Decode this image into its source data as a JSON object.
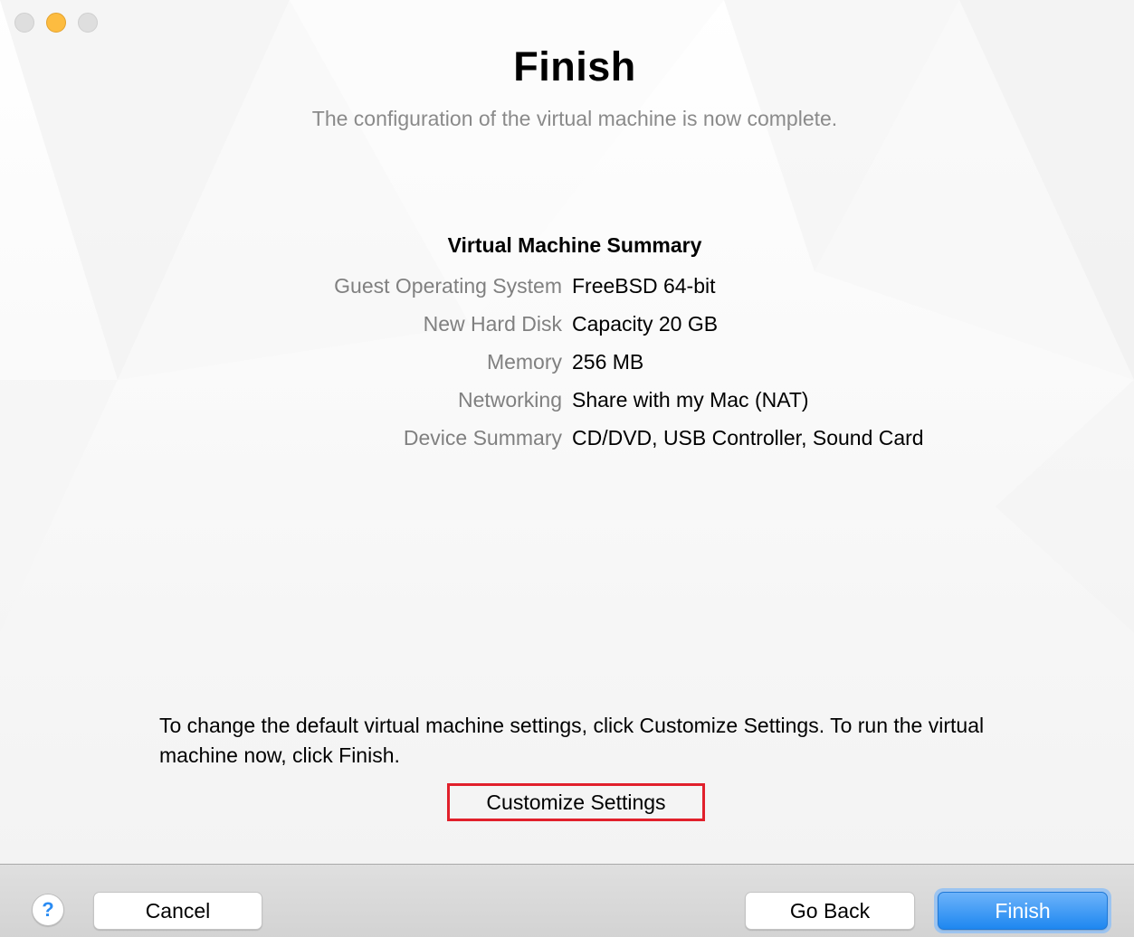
{
  "window": {
    "controls": [
      "close",
      "minimize",
      "zoom"
    ]
  },
  "header": {
    "title": "Finish",
    "subtitle": "The configuration of the virtual machine is now complete."
  },
  "summary": {
    "heading": "Virtual Machine Summary",
    "rows": [
      {
        "label": "Guest Operating System",
        "value": "FreeBSD 64-bit"
      },
      {
        "label": "New Hard Disk",
        "value": "Capacity 20 GB"
      },
      {
        "label": "Memory",
        "value": "256 MB"
      },
      {
        "label": "Networking",
        "value": "Share with my Mac (NAT)"
      },
      {
        "label": "Device Summary",
        "value": "CD/DVD, USB Controller, Sound Card"
      }
    ]
  },
  "info": {
    "text": "To change the default virtual machine settings, click Customize Settings. To run the virtual machine now, click Finish.",
    "customize_label": "Customize Settings"
  },
  "footer": {
    "help_glyph": "?",
    "cancel_label": "Cancel",
    "back_label": "Go Back",
    "finish_label": "Finish"
  },
  "colors": {
    "accent": "#1e87f0",
    "highlight_box": "#e1202b",
    "minimize_dot": "#fdbc40"
  }
}
